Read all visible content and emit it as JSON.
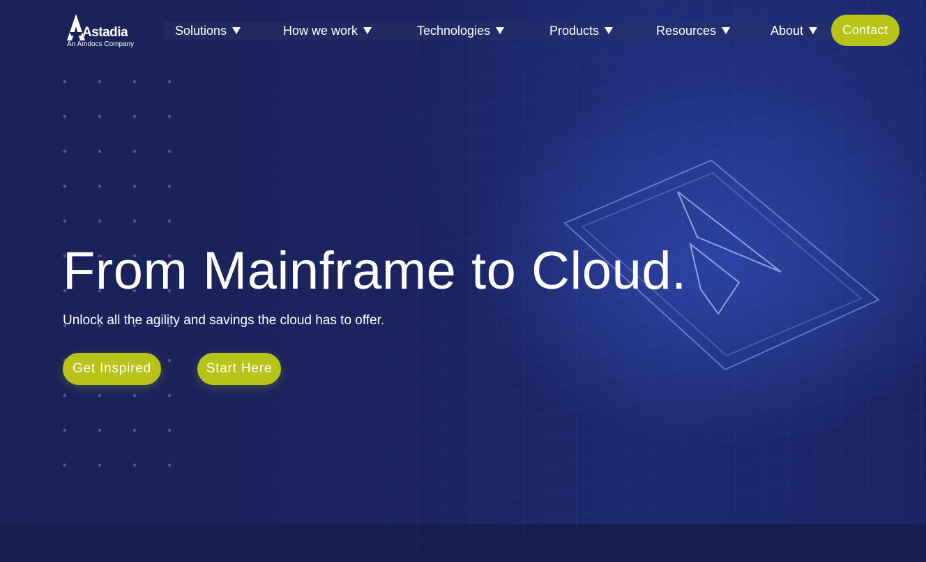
{
  "brand": {
    "name": "Astadia",
    "tagline": "An Amdocs Company",
    "icon": "astadia-logo-icon"
  },
  "nav": {
    "items": [
      {
        "label": "Solutions",
        "icon": "chevron-down-icon"
      },
      {
        "label": "How we work",
        "icon": "chevron-down-icon"
      },
      {
        "label": "Technologies",
        "icon": "chevron-down-icon"
      },
      {
        "label": "Products",
        "icon": "chevron-down-icon"
      },
      {
        "label": "Resources",
        "icon": "chevron-down-icon"
      },
      {
        "label": "About",
        "icon": "chevron-down-icon"
      }
    ],
    "contact_label": "Contact"
  },
  "hero": {
    "title": "From Mainframe to Cloud.",
    "subtitle": "Unlock all the agility and savings the cloud has to offer.",
    "primary_button": "Get Inspired",
    "secondary_button": "Start Here"
  },
  "colors": {
    "accent": "#b7c319",
    "background": "#1a2258",
    "text": "#ffffff"
  }
}
